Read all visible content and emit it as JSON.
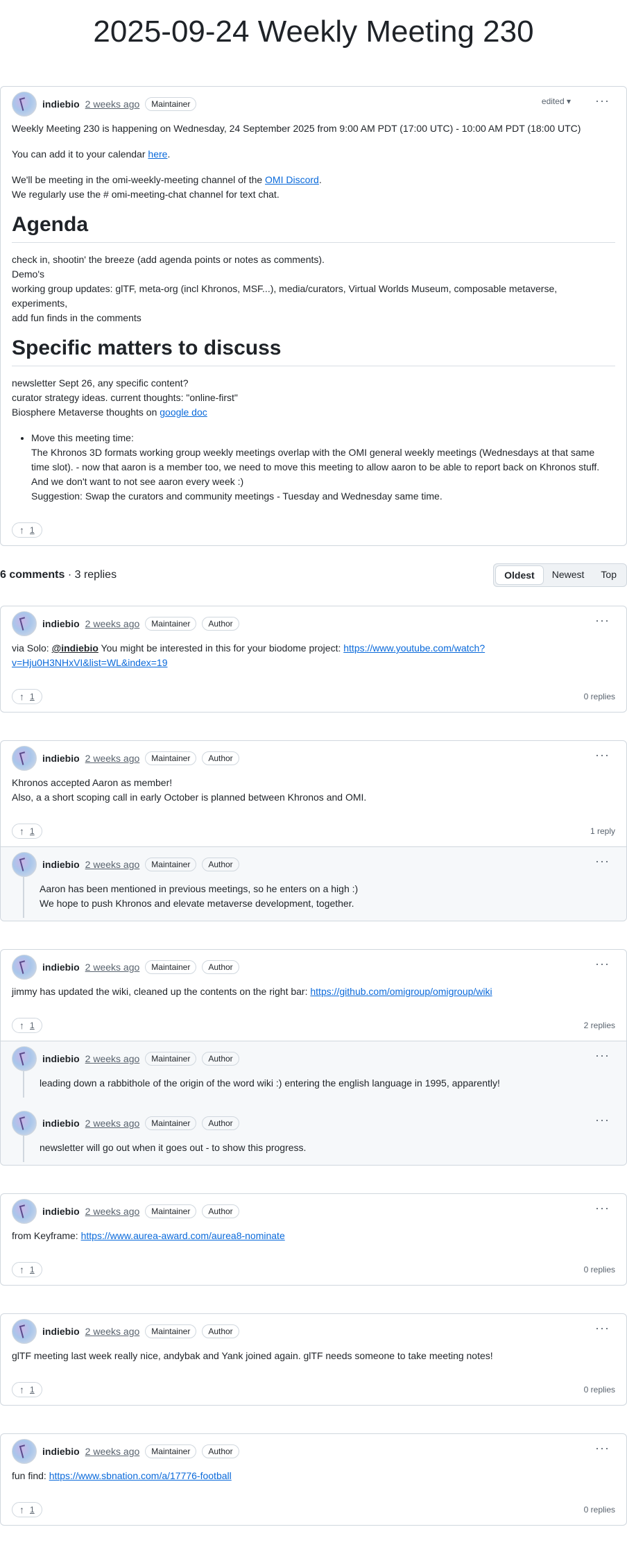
{
  "title": "2025-09-24 Weekly Meeting 230",
  "post": {
    "author": "indiebio",
    "time": "2 weeks ago",
    "badge": "Maintainer",
    "edited": "edited",
    "p1": "Weekly Meeting 230 is happening on Wednesday, 24 September 2025 from 9:00 AM PDT (17:00 UTC) - 10:00 AM PDT (18:00 UTC)",
    "p2_prefix": "You can add it to your calendar ",
    "p2_link": "here",
    "p2_suffix": ".",
    "p3_prefix": "We'll be meeting in the omi-weekly-meeting channel of the ",
    "p3_link": "OMI Discord",
    "p3_suffix": ".",
    "p3_line2": "We regularly use the # omi-meeting-chat channel for text chat.",
    "agenda_heading": "Agenda",
    "agenda_lines": [
      "check in, shootin' the breeze (add agenda points or notes as comments).",
      "Demo's",
      "working group updates: glTF, meta-org (incl Khronos, MSF...), media/curators, Virtual Worlds Museum, composable metaverse, experiments,",
      "add fun finds in the comments"
    ],
    "matters_heading": "Specific matters to discuss",
    "matters_lines": [
      "newsletter Sept 26, any specific content?",
      "curator strategy ideas. current thoughts: \"online-first\""
    ],
    "biosphere_prefix": "Biosphere Metaverse thoughts on ",
    "biosphere_link": "google doc",
    "bullet_title": "Move this meeting time:",
    "bullet_lines": [
      "The Khronos 3D formats working group weekly meetings overlap with the OMI general weekly meetings (Wednesdays at that same time slot). - now that aaron is a member too, we need to move this meeting to allow aaron to be able to report back on Khronos stuff. And we don't want to not see aaron every week :)",
      "Suggestion: Swap the curators and community meetings - Tuesday and Wednesday same time."
    ],
    "votes": "1"
  },
  "comments_bar": {
    "count": "6 comments",
    "sep": " · ",
    "replies": "3 replies",
    "sort": [
      "Oldest",
      "Newest",
      "Top"
    ]
  },
  "comments": [
    {
      "author": "indiebio",
      "time": "2 weeks ago",
      "badge1": "Maintainer",
      "badge2": "Author",
      "text_prefix": "via Solo: ",
      "mention": "@indiebio",
      "text_mid": " You might be interested in this for your biodome project: ",
      "link": "https://www.youtube.com/watch?v=Hju0H3NHxVI&list=WL&index=19",
      "votes": "1",
      "replies": "0 replies"
    },
    {
      "author": "indiebio",
      "time": "2 weeks ago",
      "badge1": "Maintainer",
      "badge2": "Author",
      "line1": "Khronos accepted Aaron as member!",
      "line2": "Also, a a short scoping call in early October is planned between Khronos and OMI.",
      "votes": "1",
      "replies": "1 reply",
      "reply": {
        "author": "indiebio",
        "time": "2 weeks ago",
        "badge1": "Maintainer",
        "badge2": "Author",
        "line1": "Aaron has been mentioned in previous meetings, so he enters on a high :)",
        "line2": "We hope to push Khronos and elevate metaverse development, together."
      }
    },
    {
      "author": "indiebio",
      "time": "2 weeks ago",
      "badge1": "Maintainer",
      "badge2": "Author",
      "text_prefix": "jimmy has updated the wiki, cleaned up the contents on the right bar: ",
      "link": "https://github.com/omigroup/omigroup/wiki",
      "votes": "1",
      "replies": "2 replies",
      "reply1": {
        "author": "indiebio",
        "time": "2 weeks ago",
        "badge1": "Maintainer",
        "badge2": "Author",
        "text": "leading down a rabbithole of the origin of the word wiki :) entering the english language in 1995, apparently!"
      },
      "reply2": {
        "author": "indiebio",
        "time": "2 weeks ago",
        "badge1": "Maintainer",
        "badge2": "Author",
        "text": "newsletter will go out when it goes out - to show this progress."
      }
    },
    {
      "author": "indiebio",
      "time": "2 weeks ago",
      "badge1": "Maintainer",
      "badge2": "Author",
      "text_prefix": "from Keyframe: ",
      "link": "https://www.aurea-award.com/aurea8-nominate",
      "votes": "1",
      "replies": "0 replies"
    },
    {
      "author": "indiebio",
      "time": "2 weeks ago",
      "badge1": "Maintainer",
      "badge2": "Author",
      "text": "glTF meeting last week really nice, andybak and Yank joined again. glTF needs someone to take meeting notes!",
      "votes": "1",
      "replies": "0 replies"
    },
    {
      "author": "indiebio",
      "time": "2 weeks ago",
      "badge1": "Maintainer",
      "badge2": "Author",
      "text_prefix": "fun find: ",
      "link": "https://www.sbnation.com/a/17776-football",
      "votes": "1",
      "replies": "0 replies"
    }
  ]
}
